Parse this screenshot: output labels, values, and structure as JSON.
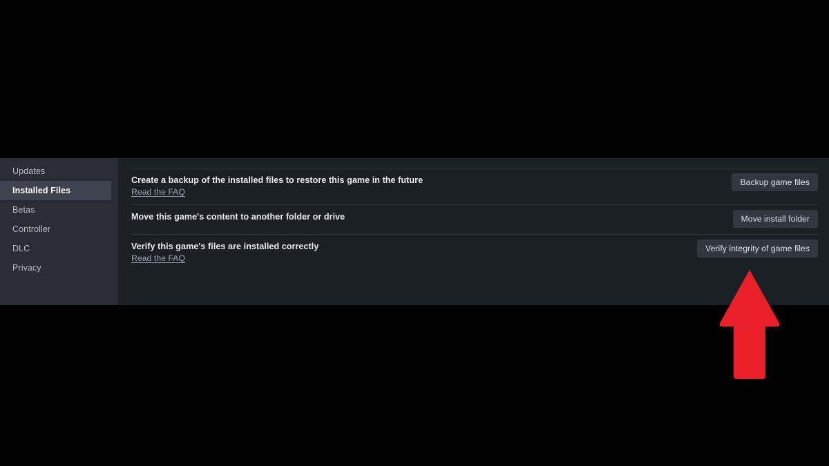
{
  "panel": {
    "sidebar": {
      "items": [
        {
          "label": "Updates",
          "selected": false
        },
        {
          "label": "Installed Files",
          "selected": true
        },
        {
          "label": "Betas",
          "selected": false
        },
        {
          "label": "Controller",
          "selected": false
        },
        {
          "label": "DLC",
          "selected": false
        },
        {
          "label": "Privacy",
          "selected": false
        }
      ]
    },
    "rows": [
      {
        "title": "Create a backup of the installed files to restore this game in the future",
        "link": "Read the FAQ",
        "button": "Backup game files"
      },
      {
        "title": "Move this game's content to another folder or drive",
        "link": "",
        "button": "Move install folder"
      },
      {
        "title": "Verify this game's files are installed correctly",
        "link": "Read the FAQ",
        "button": "Verify integrity of game files"
      }
    ]
  },
  "annotation": {
    "icon": "up-arrow-icon",
    "color": "#ea2028",
    "points_to": "Verify integrity of game files"
  },
  "colors": {
    "sidebar_bg": "#2a2d35",
    "sidebar_selected_bg": "#3d434e",
    "content_bg": "#1b2027",
    "button_bg": "#32373f",
    "separator": "#2c333c",
    "page_bg": "#000000",
    "text_primary": "#e9eaec",
    "text_muted": "#b8bcc2",
    "link": "#9aa3ad",
    "arrow": "#ea2028"
  }
}
